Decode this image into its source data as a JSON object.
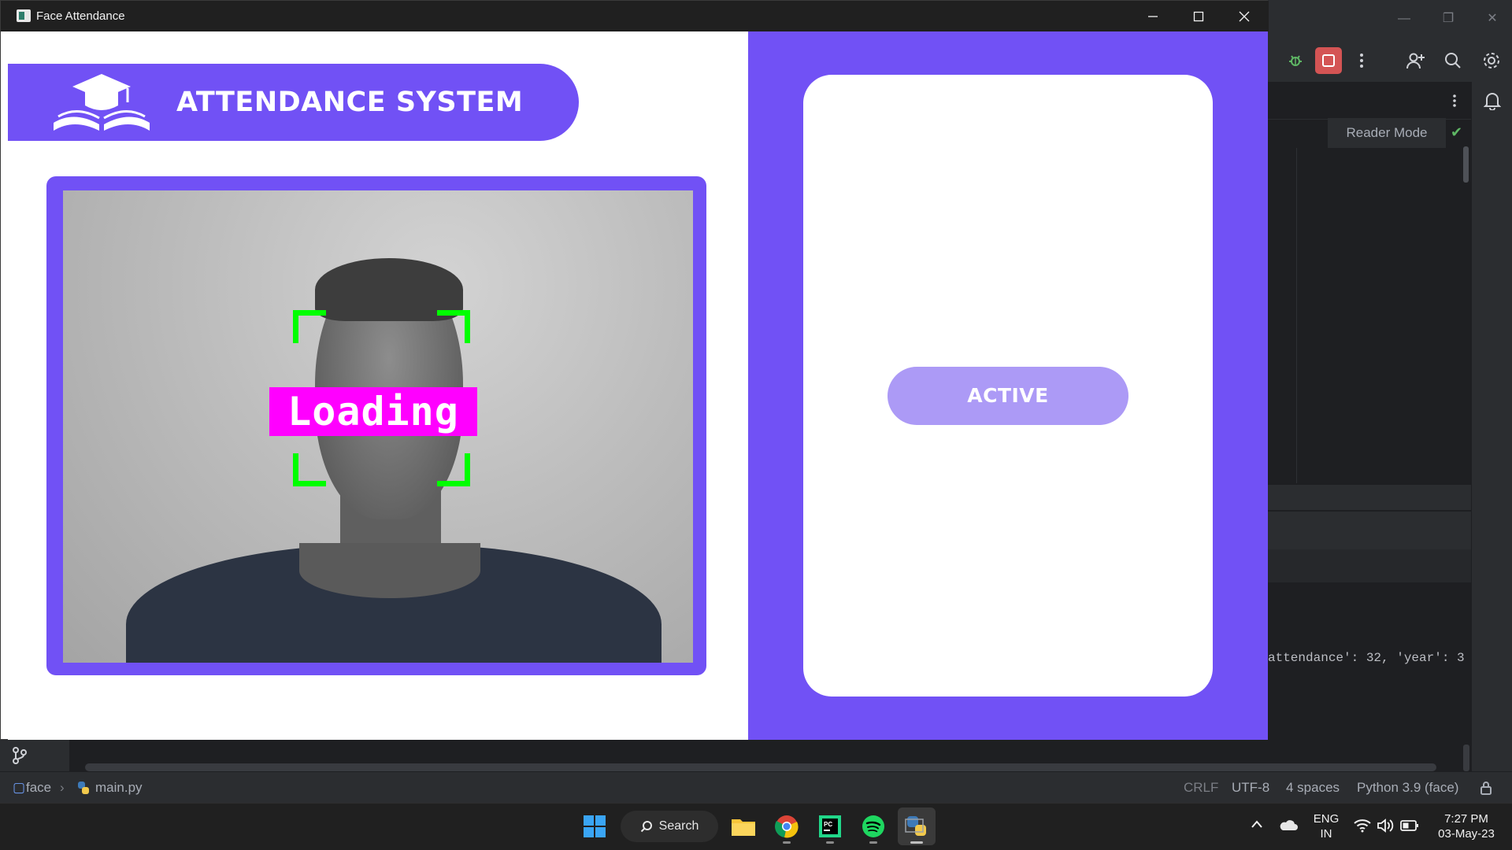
{
  "window": {
    "title": "Face Attendance",
    "minimize_glyph": "—",
    "maximize_glyph": "☐",
    "close_glyph": "✕"
  },
  "header": {
    "title": "ATTENDANCE SYSTEM",
    "logo_icon": "graduation-cap-book-icon"
  },
  "camera": {
    "overlay_label": "Loading",
    "box_color": "#00ff00",
    "label_bg": "#ff00ff"
  },
  "status": {
    "label": "ACTIVE"
  },
  "ide": {
    "reader_mode": "Reader Mode",
    "console_text": "attendance': 32, 'year': 3",
    "breadcrumb_project": "face",
    "breadcrumb_file": "main.py",
    "line_separator": "CRLF",
    "encoding": "UTF-8",
    "indent": "4 spaces",
    "interpreter": "Python 3.9 (face)"
  },
  "taskbar": {
    "search_label": "Search",
    "language_line1": "ENG",
    "language_line2": "IN",
    "time": "7:27 PM",
    "date": "03-May-23"
  },
  "colors": {
    "accent": "#7151f5",
    "accent_light": "#ac9af6",
    "detect_box": "#00ff00",
    "label_bg": "#ff00ff"
  }
}
